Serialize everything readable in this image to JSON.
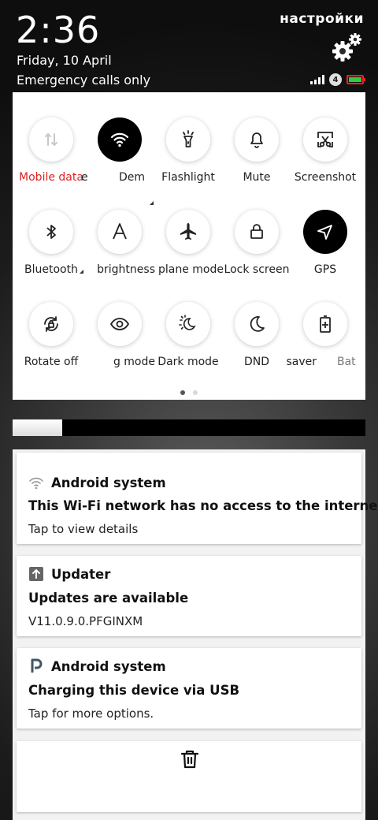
{
  "status": {
    "time": "2:36",
    "date": "Friday, 10 April",
    "network_status": "Emergency calls only",
    "settings_label": "настройки",
    "network_badge": "4"
  },
  "quick_settings": {
    "rows": [
      [
        {
          "label": "Mobile data",
          "icon": "mobile-data-icon",
          "active": false,
          "color": "#e02020"
        },
        {
          "label": "e",
          "icon": "wifi-icon",
          "active": true
        },
        {
          "label": "Dem",
          "icon": "wifi-icon",
          "active": false
        },
        {
          "label": "Flashlight",
          "icon": "flashlight-icon",
          "active": false
        },
        {
          "label": "Mute",
          "icon": "bell-icon",
          "active": false
        },
        {
          "label": "Screenshot",
          "icon": "screenshot-icon",
          "active": false
        }
      ],
      [
        {
          "label": "Bluetooth",
          "icon": "bluetooth-icon",
          "active": false
        },
        {
          "label": "brightness",
          "icon": "auto-brightness-icon",
          "active": false
        },
        {
          "label": "plane mode",
          "icon": "airplane-icon",
          "active": false
        },
        {
          "label": "Lock screen",
          "icon": "lock-icon",
          "active": false
        },
        {
          "label": "GPS",
          "icon": "gps-icon",
          "active": true
        }
      ],
      [
        {
          "label": "Rotate off",
          "icon": "rotate-lock-icon",
          "active": false
        },
        {
          "label": "g mode",
          "icon": "eye-icon",
          "active": false
        },
        {
          "label": "Dark mode",
          "icon": "dark-mode-icon",
          "active": false
        },
        {
          "label": "DND",
          "icon": "moon-icon",
          "active": false
        },
        {
          "label": "saver",
          "icon": "battery-saver-icon",
          "active": false
        },
        {
          "label": "Bat",
          "icon": "battery-icon",
          "active": false
        }
      ]
    ],
    "page_count": 2,
    "active_page": 1
  },
  "brightness": {
    "level": 0.14
  },
  "notifications": [
    {
      "app": "Android system",
      "icon": "wifi-question-icon",
      "title": "This Wi-Fi network has no access to the internet",
      "text": "Tap to view details"
    },
    {
      "app": "Updater",
      "icon": "updater-icon",
      "title": "Updates are available",
      "text": "V11.0.9.0.PFGINXM"
    },
    {
      "app": "Android system",
      "icon": "usb-p-icon",
      "title": "Charging this device via USB",
      "text": "Tap for more options."
    }
  ],
  "colors": {
    "accent_red": "#e02020",
    "battery_border": "#e22222",
    "battery_fill": "#2ecc40",
    "tile_active": "#000000"
  }
}
